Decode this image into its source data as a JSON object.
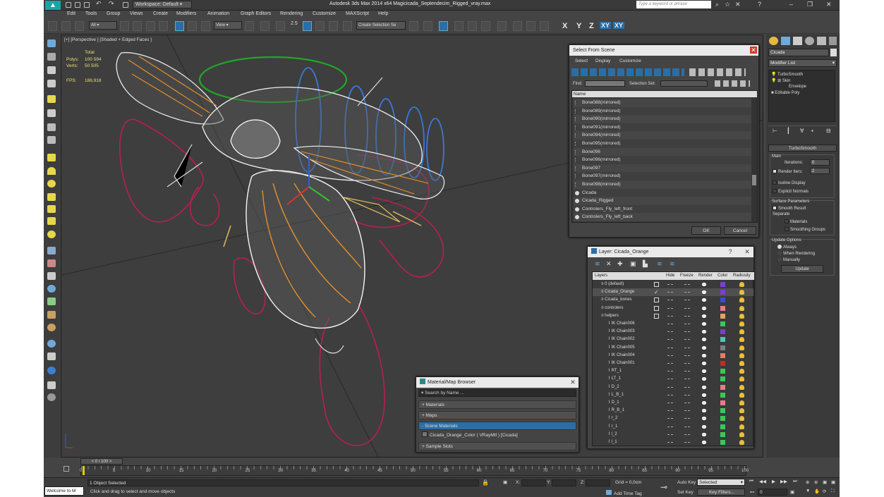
{
  "titlebar": {
    "workspace": "Workspace: Default",
    "title": "Autodesk 3ds Max  2014 x64     Magicicada_Septendecim_Rigged_vray.max",
    "search_placeholder": "Type a keyword or phrase"
  },
  "menu": [
    "Edit",
    "Tools",
    "Group",
    "Views",
    "Create",
    "Modifiers",
    "Animation",
    "Graph Editors",
    "Rendering",
    "Customize",
    "MAXScript",
    "Help"
  ],
  "toolbar": {
    "filter": "All",
    "ref_coord": "View",
    "selection_set": "Create Selection Se",
    "axes": [
      "X",
      "Y",
      "Z",
      "XY",
      "XY"
    ],
    "snap_value": "2.5"
  },
  "viewport": {
    "label": "[+] [Perspective ] [Shaded + Edged Faces ]",
    "stats_title": "Total",
    "polys_label": "Polys:",
    "polys_value": "100 594",
    "verts_label": "Verts:",
    "verts_value": "50 505",
    "fps_label": "FPS:",
    "fps_value": "188,918"
  },
  "command_panel": {
    "object_name": "Cicada",
    "modifier_list": "Modifier List",
    "stack": [
      "TurboSmooth",
      "Skin",
      "Envelope",
      "Editable Poly"
    ],
    "rollout_title": "TurboSmooth",
    "main_label": "Main",
    "iterations_label": "Iterations:",
    "iterations_value": "0",
    "render_iters_label": "Render Iters:",
    "render_iters_value": "2",
    "isoline": "Isoline Display",
    "explicit_normals": "Explicit Normals",
    "surface_params": "Surface Parameters",
    "smooth_result": "Smooth Result",
    "separate": "Separate",
    "materials": "Materials",
    "smoothing_groups": "Smoothing Groups",
    "update_options": "Update Options",
    "always": "Always",
    "when_rendering": "When Rendering",
    "manually": "Manually",
    "update_button": "Update"
  },
  "select_from_scene": {
    "title": "Select From Scene",
    "tabs": [
      "Select",
      "Display",
      "Customize"
    ],
    "find_label": "Find:",
    "selection_set_label": "Selection Set:",
    "column_name": "Name",
    "items": [
      "Bone088(mirrored)",
      "Bone089(mirrored)",
      "Bone090(mirrored)",
      "Bone091(mirrored)",
      "Bone094(mirrored)",
      "Bone095(mirrored)",
      "Bone096",
      "Bone096(mirrored)",
      "Bone097",
      "Bone097(mirrored)",
      "Bone098(mirrored)",
      "Cicada",
      "Cicada_Rigged",
      "Controlers_Fly_left_front",
      "Controlers_Fly_left_back"
    ],
    "ok": "OK",
    "cancel": "Cancel"
  },
  "layer_dialog": {
    "title": "Layer: Cicada_Orange",
    "help": "?",
    "columns": [
      "Layers",
      "Hide",
      "Freeze",
      "Render",
      "Color",
      "Radiosity"
    ],
    "rows": [
      {
        "name": "0 (default)",
        "indent": 1,
        "box": true,
        "color": "#7a3fd6"
      },
      {
        "name": "Cicada_Orange",
        "indent": 1,
        "check": true,
        "color": "#7a3fd6"
      },
      {
        "name": "Cicada_bones",
        "indent": 1,
        "box": true,
        "color": "#3a4ad8"
      },
      {
        "name": "controlers",
        "indent": 1,
        "box": true,
        "color": "#e87b8e"
      },
      {
        "name": "helpers",
        "indent": 1,
        "box": true,
        "color": "#e8a060"
      },
      {
        "name": "IK Chain006",
        "indent": 2,
        "color": "#38c858"
      },
      {
        "name": "IK Chain003",
        "indent": 2,
        "color": "#7a3fd6"
      },
      {
        "name": "IK Chain002",
        "indent": 2,
        "color": "#48c8b8"
      },
      {
        "name": "IK Chain005",
        "indent": 2,
        "color": "#7f7f7f"
      },
      {
        "name": "IK Chain004",
        "indent": 2,
        "color": "#e87b5e"
      },
      {
        "name": "IK Chain001",
        "indent": 2,
        "color": "#c82828"
      },
      {
        "name": "RT_1",
        "indent": 2,
        "color": "#38c858"
      },
      {
        "name": "LT_1",
        "indent": 2,
        "color": "#38c858"
      },
      {
        "name": "D_2",
        "indent": 2,
        "color": "#e87b8e"
      },
      {
        "name": "L_B_1",
        "indent": 2,
        "color": "#38c858"
      },
      {
        "name": "D_1",
        "indent": 2,
        "color": "#e87b8e"
      },
      {
        "name": "R_B_1",
        "indent": 2,
        "color": "#38c858"
      },
      {
        "name": "r_2",
        "indent": 2,
        "color": "#38c858"
      },
      {
        "name": "r_1",
        "indent": 2,
        "color": "#38c858"
      },
      {
        "name": "l_2",
        "indent": 2,
        "color": "#38c858"
      },
      {
        "name": "l_1",
        "indent": 2,
        "color": "#38c858"
      }
    ]
  },
  "material_browser": {
    "title": "Material/Map Browser",
    "search": "Search by Name ...",
    "sections": [
      "+ Materials",
      "+ Maps",
      "- Scene Materials",
      "+ Sample Slots"
    ],
    "scene_material": "Cicada_Orange_Color  ( VRayMtl )  [Cicada]"
  },
  "timeline": {
    "frame": "0 / 100",
    "ticks": [
      "0",
      "5",
      "10",
      "15",
      "20",
      "25",
      "30",
      "35",
      "40",
      "45",
      "50",
      "55",
      "60",
      "65",
      "70",
      "75",
      "80",
      "85",
      "90",
      "95",
      "100"
    ]
  },
  "status": {
    "listener": "Welcome to M",
    "selected": "1 Object Selected",
    "prompt": "Click and drag to select and move objects",
    "x_label": "X:",
    "y_label": "Y:",
    "z_label": "Z:",
    "grid": "Grid = 0,0cm",
    "add_time_tag": "Add Time Tag",
    "auto_key": "Auto Key",
    "auto_key_mode": "Selected",
    "set_key": "Set Key",
    "key_filters": "Key Filters...",
    "current_frame": "0"
  }
}
